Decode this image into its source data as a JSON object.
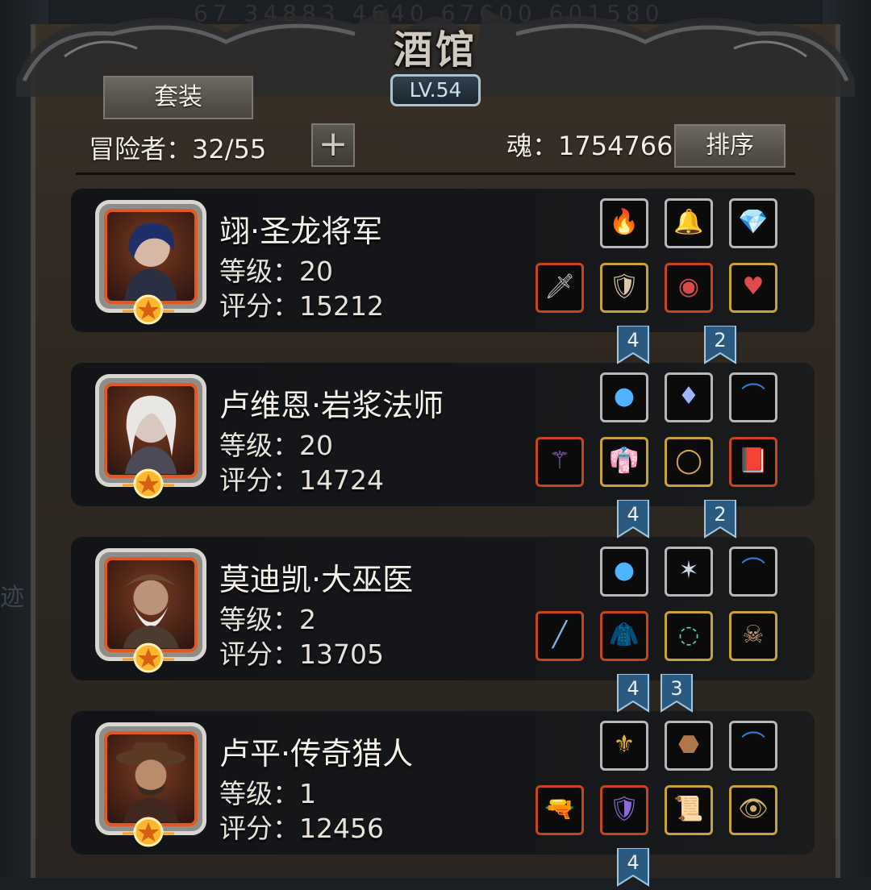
{
  "background": {
    "top_numbers": "67  34883  4640  67600  601580",
    "left_text": "迹"
  },
  "header": {
    "title": "酒馆",
    "level": "LV.54",
    "set_button": "套装",
    "sort_button": "排序",
    "plus_button": "+",
    "adventurer_label": "冒险者：32/55",
    "soul_label": "魂：1754766"
  },
  "heroes": [
    {
      "name": "翊·圣龙将军",
      "level_text": "等级：20",
      "score_text": "评分：15212",
      "slots_top": [
        {
          "icon": "fire-orb-icon",
          "frame": "silver",
          "glyph": "🔥"
        },
        {
          "icon": "bell-charm-icon",
          "frame": "silver",
          "glyph": "🔔"
        },
        {
          "icon": "purple-gem-icon",
          "frame": "silver",
          "glyph": "💎"
        }
      ],
      "slots_bottom": [
        {
          "icon": "greatsword-icon",
          "frame": "red",
          "glyph": "🗡"
        },
        {
          "icon": "dragon-armor-icon",
          "frame": "gold",
          "glyph": "🛡"
        },
        {
          "icon": "eye-ring-icon",
          "frame": "red",
          "glyph": "◉"
        },
        {
          "icon": "heart-amulet-icon",
          "frame": "gold",
          "glyph": "♥"
        }
      ],
      "set_counts": [
        "4",
        "2"
      ]
    },
    {
      "name": "卢维恩·岩浆法师",
      "level_text": "等级：20",
      "score_text": "评分：14724",
      "slots_top": [
        {
          "icon": "blue-orb-icon",
          "frame": "silver",
          "glyph": "●"
        },
        {
          "icon": "pendant-necklace-icon",
          "frame": "silver",
          "glyph": "♦"
        },
        {
          "icon": "blue-bow-icon",
          "frame": "silver",
          "glyph": "⌒"
        }
      ],
      "slots_bottom": [
        {
          "icon": "dark-staff-icon",
          "frame": "red",
          "glyph": "⚚"
        },
        {
          "icon": "robe-icon",
          "frame": "gold",
          "glyph": "👘"
        },
        {
          "icon": "gold-ring-icon",
          "frame": "gold",
          "glyph": "◯"
        },
        {
          "icon": "spellbook-icon",
          "frame": "red",
          "glyph": "📕"
        }
      ],
      "set_counts": [
        "4",
        "2"
      ]
    },
    {
      "name": "莫迪凯·大巫医",
      "level_text": "等级：2",
      "score_text": "评分：13705",
      "slots_top": [
        {
          "icon": "blue-orb-icon",
          "frame": "silver",
          "glyph": "●"
        },
        {
          "icon": "crossed-sigil-icon",
          "frame": "silver",
          "glyph": "✶"
        },
        {
          "icon": "blue-bow-icon",
          "frame": "silver",
          "glyph": "⌒"
        }
      ],
      "slots_bottom": [
        {
          "icon": "ice-wand-icon",
          "frame": "red",
          "glyph": "╱"
        },
        {
          "icon": "hooded-cloak-icon",
          "frame": "red",
          "glyph": "🧥"
        },
        {
          "icon": "jade-necklace-icon",
          "frame": "gold",
          "glyph": "◌"
        },
        {
          "icon": "skull-mask-icon",
          "frame": "gold",
          "glyph": "☠"
        }
      ],
      "set_counts": [
        "4",
        "3"
      ]
    },
    {
      "name": "卢平·传奇猎人",
      "level_text": "等级：1",
      "score_text": "评分：12456",
      "slots_top": [
        {
          "icon": "gold-crest-icon",
          "frame": "silver",
          "glyph": "⚜"
        },
        {
          "icon": "leather-shield-icon",
          "frame": "silver",
          "glyph": "⬣"
        },
        {
          "icon": "blue-bow-icon",
          "frame": "silver",
          "glyph": "⌒"
        }
      ],
      "slots_bottom": [
        {
          "icon": "flintlock-pistol-icon",
          "frame": "red",
          "glyph": "🔫"
        },
        {
          "icon": "purple-armor-icon",
          "frame": "red",
          "glyph": "🛡"
        },
        {
          "icon": "green-scroll-icon",
          "frame": "gold",
          "glyph": "📜"
        },
        {
          "icon": "eye-amulet-icon",
          "frame": "gold",
          "glyph": "👁"
        }
      ],
      "set_counts": [
        "4"
      ]
    }
  ],
  "colors": {
    "panel": "#2e2821",
    "card": "#141619",
    "frame_red": "#c8431e",
    "frame_gold": "#c9a23a",
    "ribbon": "#2a5a80"
  }
}
